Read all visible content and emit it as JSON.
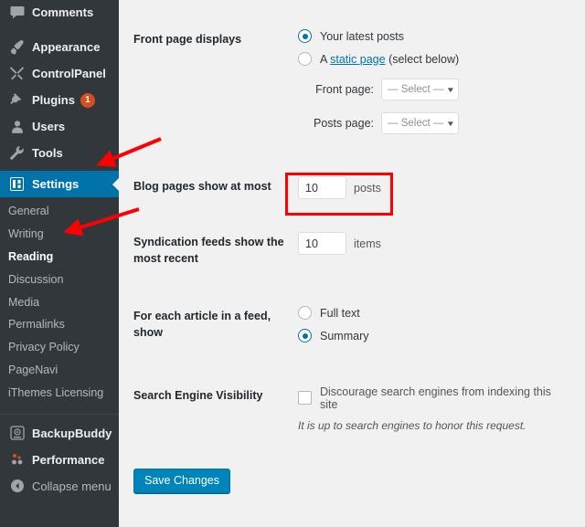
{
  "colors": {
    "sidebar_bg": "#32373c",
    "sidebar_current": "#0073aa",
    "content_bg": "#f1f1f1",
    "badge": "#d54e21",
    "button": "#0085ba",
    "annotation": "#ff0000",
    "link": "#0073aa"
  },
  "sidebar": {
    "items": [
      {
        "label": "Comments",
        "icon": "comments-icon",
        "current": false
      },
      {
        "label": "Appearance",
        "icon": "appearance-paintbrush-icon",
        "current": false
      },
      {
        "label": "ControlPanel",
        "icon": "tools-cross-icon",
        "current": false
      },
      {
        "label": "Plugins",
        "icon": "plugins-plug-icon",
        "current": false,
        "badge": "1"
      },
      {
        "label": "Users",
        "icon": "users-icon",
        "current": false
      },
      {
        "label": "Tools",
        "icon": "tools-wrench-icon",
        "current": false
      },
      {
        "label": "Settings",
        "icon": "settings-sliders-icon",
        "current": true
      }
    ],
    "submenu": [
      {
        "label": "General",
        "current": false
      },
      {
        "label": "Writing",
        "current": false
      },
      {
        "label": "Reading",
        "current": true
      },
      {
        "label": "Discussion",
        "current": false
      },
      {
        "label": "Media",
        "current": false
      },
      {
        "label": "Permalinks",
        "current": false
      },
      {
        "label": "Privacy Policy",
        "current": false
      },
      {
        "label": "PageNavi",
        "current": false
      },
      {
        "label": "iThemes Licensing",
        "current": false
      }
    ],
    "bottom_items": [
      {
        "label": "BackupBuddy",
        "icon": "backupbuddy-drive-icon"
      },
      {
        "label": "Performance",
        "icon": "performance-dots-icon"
      },
      {
        "label": "Collapse menu",
        "icon": "collapse-arrow-icon"
      }
    ]
  },
  "main": {
    "front_page": {
      "label": "Front page displays",
      "option_latest": "Your latest posts",
      "option_static_prefix": "A ",
      "option_static_link": "static page",
      "option_static_suffix": " (select below)",
      "selected": "latest",
      "front_page_label": "Front page:",
      "front_page_value": "— Select —",
      "posts_page_label": "Posts page:",
      "posts_page_value": "— Select —"
    },
    "blog_pages": {
      "label": "Blog pages show at most",
      "value": "10",
      "unit": "posts"
    },
    "syndication": {
      "label": "Syndication feeds show the most recent",
      "value": "10",
      "unit": "items"
    },
    "feed_show": {
      "label": "For each article in a feed, show",
      "option_full": "Full text",
      "option_summary": "Summary",
      "selected": "summary"
    },
    "search_visibility": {
      "label": "Search Engine Visibility",
      "checkbox_label": "Discourage search engines from indexing this site",
      "checked": false,
      "hint": "It is up to search engines to honor this request."
    },
    "save_button": "Save Changes"
  }
}
